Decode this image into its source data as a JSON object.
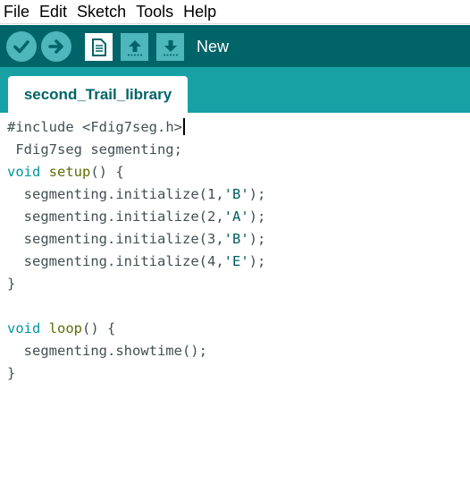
{
  "menu": {
    "items": [
      "File",
      "Edit",
      "Sketch",
      "Tools",
      "Help"
    ]
  },
  "toolbar": {
    "buttons": [
      {
        "name": "verify",
        "icon": "checkmark-icon"
      },
      {
        "name": "upload",
        "icon": "arrow-right-icon"
      },
      {
        "name": "new",
        "icon": "document-icon"
      },
      {
        "name": "open",
        "icon": "arrow-up-icon"
      },
      {
        "name": "save",
        "icon": "arrow-down-icon"
      }
    ],
    "hover_label": "New",
    "colors": {
      "bar": "#006468",
      "button": "#4db7bb",
      "active_button": "#ffffff"
    }
  },
  "tabs": [
    {
      "label": "second_Trail_library",
      "active": true
    }
  ],
  "editor": {
    "lines": [
      [
        {
          "t": "#include ",
          "c": "plain"
        },
        {
          "t": "<Fdig7seg.h>",
          "c": "plain"
        }
      ],
      [
        {
          "t": " Fdig7seg segmenting;",
          "c": "plain"
        }
      ],
      [
        {
          "t": "void",
          "c": "kw"
        },
        {
          "t": " ",
          "c": "plain"
        },
        {
          "t": "setup",
          "c": "kwfn"
        },
        {
          "t": "() {",
          "c": "plain"
        }
      ],
      [
        {
          "t": "  segmenting.",
          "c": "plain"
        },
        {
          "t": "initialize",
          "c": "plain"
        },
        {
          "t": "(1,",
          "c": "plain"
        },
        {
          "t": "'B'",
          "c": "str"
        },
        {
          "t": ");",
          "c": "plain"
        }
      ],
      [
        {
          "t": "  segmenting.",
          "c": "plain"
        },
        {
          "t": "initialize",
          "c": "plain"
        },
        {
          "t": "(2,",
          "c": "plain"
        },
        {
          "t": "'A'",
          "c": "str"
        },
        {
          "t": ");",
          "c": "plain"
        }
      ],
      [
        {
          "t": "  segmenting.",
          "c": "plain"
        },
        {
          "t": "initialize",
          "c": "plain"
        },
        {
          "t": "(3,",
          "c": "plain"
        },
        {
          "t": "'B'",
          "c": "str"
        },
        {
          "t": ");",
          "c": "plain"
        }
      ],
      [
        {
          "t": "  segmenting.",
          "c": "plain"
        },
        {
          "t": "initialize",
          "c": "plain"
        },
        {
          "t": "(4,",
          "c": "plain"
        },
        {
          "t": "'E'",
          "c": "str"
        },
        {
          "t": ");",
          "c": "plain"
        }
      ],
      [
        {
          "t": "}",
          "c": "plain"
        }
      ],
      [
        {
          "t": "",
          "c": "plain"
        }
      ],
      [
        {
          "t": "void",
          "c": "kw"
        },
        {
          "t": " ",
          "c": "plain"
        },
        {
          "t": "loop",
          "c": "kwfn"
        },
        {
          "t": "() {",
          "c": "plain"
        }
      ],
      [
        {
          "t": "  segmenting.showtime();",
          "c": "plain"
        }
      ],
      [
        {
          "t": "}",
          "c": "plain"
        }
      ]
    ],
    "colors": {
      "kw": "#00979c",
      "kwfn": "#5e6d03",
      "str": "#005c5f",
      "plain": "#434f54"
    }
  }
}
